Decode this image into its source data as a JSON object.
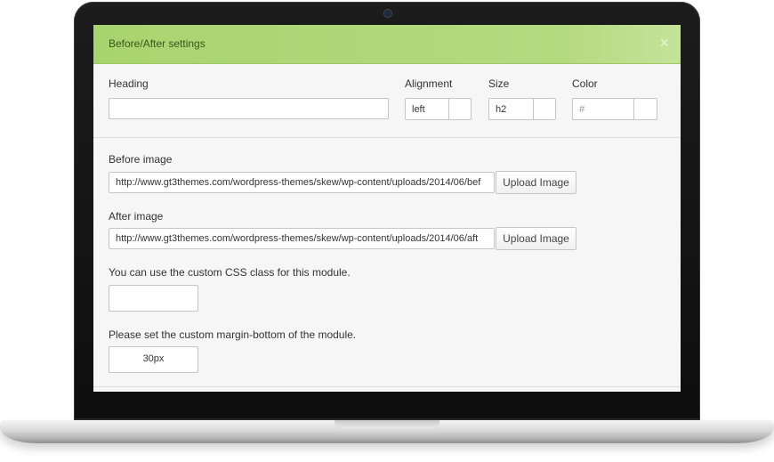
{
  "dialog": {
    "title": "Before/After settings",
    "close_glyph": "×"
  },
  "heading": {
    "label": "Heading",
    "value": ""
  },
  "alignment": {
    "label": "Alignment",
    "value": "left"
  },
  "size": {
    "label": "Size",
    "value": "h2"
  },
  "color": {
    "label": "Color",
    "placeholder": "#"
  },
  "before_image": {
    "label": "Before image",
    "value": "http://www.gt3themes.com/wordpress-themes/skew/wp-content/uploads/2014/06/bef",
    "button": "Upload Image"
  },
  "after_image": {
    "label": "After image",
    "value": "http://www.gt3themes.com/wordpress-themes/skew/wp-content/uploads/2014/06/aft",
    "button": "Upload Image"
  },
  "css_class": {
    "label": "You can use the custom CSS class for this module.",
    "value": ""
  },
  "margin_bottom": {
    "label": "Please set the custom margin-bottom of the module.",
    "value": "30px"
  },
  "colors": {
    "header_green": "#a8d46f",
    "title_text": "#3b5418",
    "panel_bg": "#f6f6f6"
  }
}
